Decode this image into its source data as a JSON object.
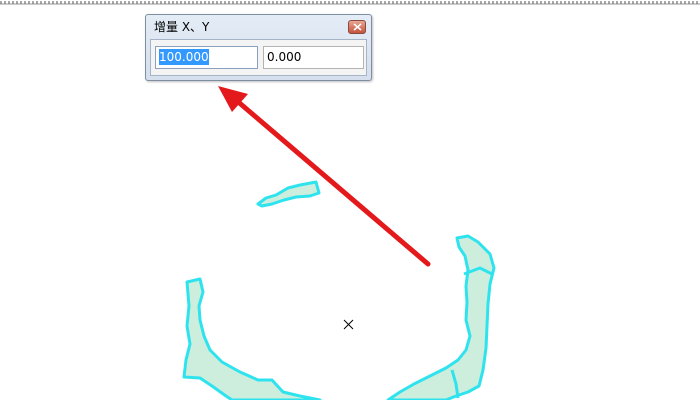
{
  "dialog": {
    "title": "增量 X、Y",
    "x_value": "100.000",
    "y_value": "0.000",
    "x_selected": true
  },
  "canvas": {
    "cursor": "crosshair-cursor",
    "arrow_color": "#e3191c",
    "polygon_fill": "#cdeedd",
    "polygon_stroke": "#2fe3ee"
  },
  "icons": {
    "close": "close-icon"
  }
}
